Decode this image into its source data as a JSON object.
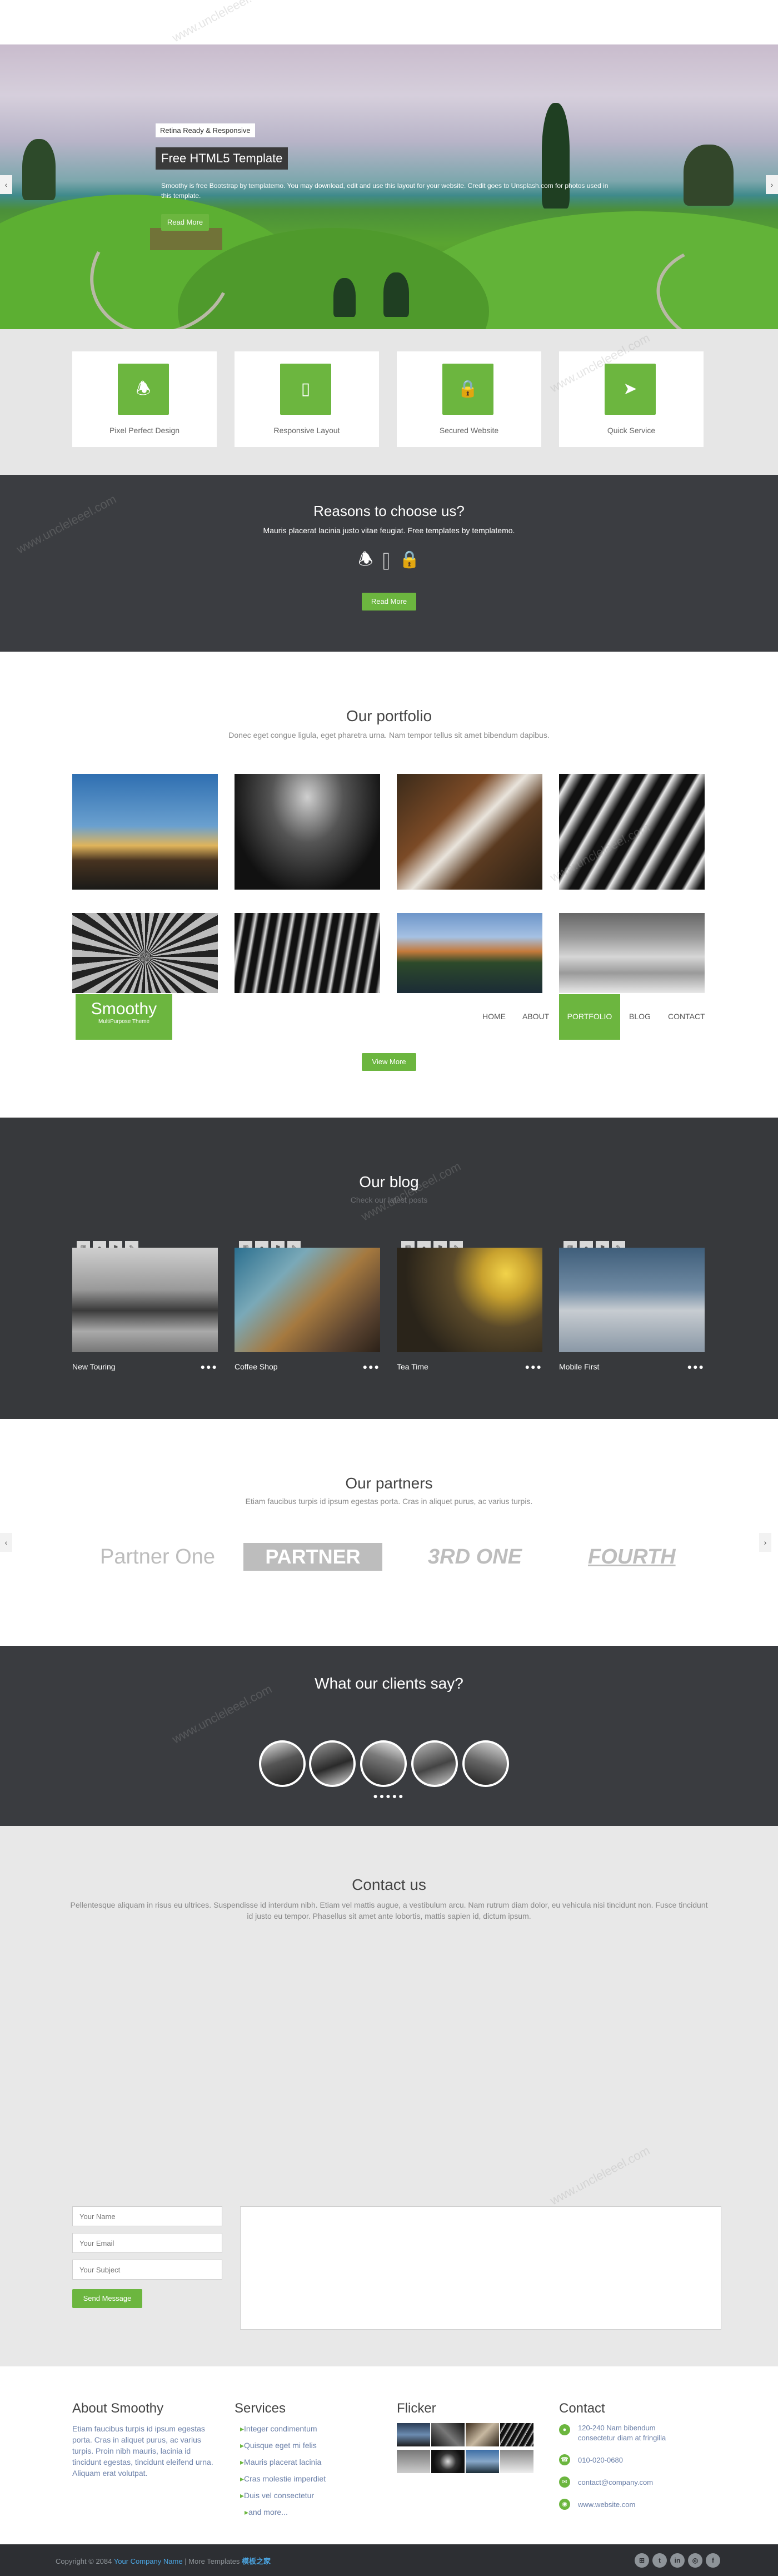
{
  "hero": {
    "label": "Retina Ready & Responsive",
    "title": "Free HTML5 Template",
    "text": "Smoothy is free Bootstrap by templatemo. You may download, edit and use this layout for your website. Credit goes to Unsplash.com for photos used in this template.",
    "button": "Read More",
    "prev_icon": "chevron-left-icon",
    "next_icon": "chevron-right-icon"
  },
  "features": [
    {
      "label": "Pixel Perfect Design",
      "icon": "bell-icon"
    },
    {
      "label": "Responsive Layout",
      "icon": "tablet-icon"
    },
    {
      "label": "Secured Website",
      "icon": "lock-icon"
    },
    {
      "label": "Quick Service",
      "icon": "rocket-icon"
    }
  ],
  "reasons": {
    "title": "Reasons to choose us?",
    "subtitle": "Mauris placerat lacinia justo vitae feugiat. Free templates by templatemo.",
    "button": "Read More"
  },
  "portfolio": {
    "title": "Our portfolio",
    "subtitle": "Donec eget congue ligula, eget pharetra urna. Nam tempor tellus sit amet bibendum dapibus.",
    "button": "View More"
  },
  "navbar": {
    "logo": "Smoothy",
    "logo_sub": "MultiPurpose Theme",
    "items": [
      "HOME",
      "ABOUT",
      "PORTFOLIO",
      "BLOG",
      "CONTACT"
    ],
    "active": "PORTFOLIO"
  },
  "blog": {
    "title": "Our blog",
    "subtitle": "Check our latest posts",
    "posts": [
      {
        "title": "New Touring"
      },
      {
        "title": "Coffee Shop"
      },
      {
        "title": "Tea Time"
      },
      {
        "title": "Mobile First"
      }
    ],
    "more_dots": "●●●"
  },
  "partners": {
    "title": "Our partners",
    "subtitle": "Etiam faucibus turpis id ipsum egestas porta. Cras in aliquet purus, ac varius turpis.",
    "logos": [
      "Partner One",
      "PARTNER TWO",
      "3RD ONE",
      "FOURTH"
    ]
  },
  "testimonials": {
    "title": "What our clients say?",
    "dots": "●●●●●"
  },
  "contact": {
    "title": "Contact us",
    "text": "Pellentesque aliquam in risus eu ultrices. Suspendisse id interdum nibh. Etiam vel mattis augue, a vestibulum arcu. Nam rutrum diam dolor, eu vehicula nisi tincidunt non. Fusce tincidunt id justo eu tempor. Phasellus sit amet ante lobortis, mattis sapien id, dictum ipsum.",
    "name_placeholder": "Your Name",
    "email_placeholder": "Your Email",
    "subject_placeholder": "Your Subject",
    "send_button": "Send Message"
  },
  "footer": {
    "about_title": "About Smoothy",
    "about_text": "Etiam faucibus turpis id ipsum egestas porta. Cras in aliquet purus, ac varius turpis. Proin nibh mauris, lacinia id tincidunt egestas, tincidunt eleifend urna. Aliquam erat volutpat.",
    "services_title": "Services",
    "services": [
      "Integer condimentum",
      "Quisque eget mi felis",
      "Mauris placerat lacinia",
      "Cras molestie imperdiet",
      "Duis vel consectetur",
      "and more..."
    ],
    "flickr_title": "Flicker",
    "contact_title": "Contact",
    "address": "120-240 Nam bibendum consectetur diam at fringilla",
    "phone": "010-020-0680",
    "email": "contact@company.com",
    "website": "www.website.com",
    "copyright": "Copyright © 2084",
    "company": "Your Company Name",
    "more": "| More Templates",
    "more_link": "模板之家",
    "social": [
      "rss-icon",
      "twitter-icon",
      "linkedin-icon",
      "dribbble-icon",
      "facebook-icon"
    ]
  },
  "watermark": "www.uncleleeel.com"
}
